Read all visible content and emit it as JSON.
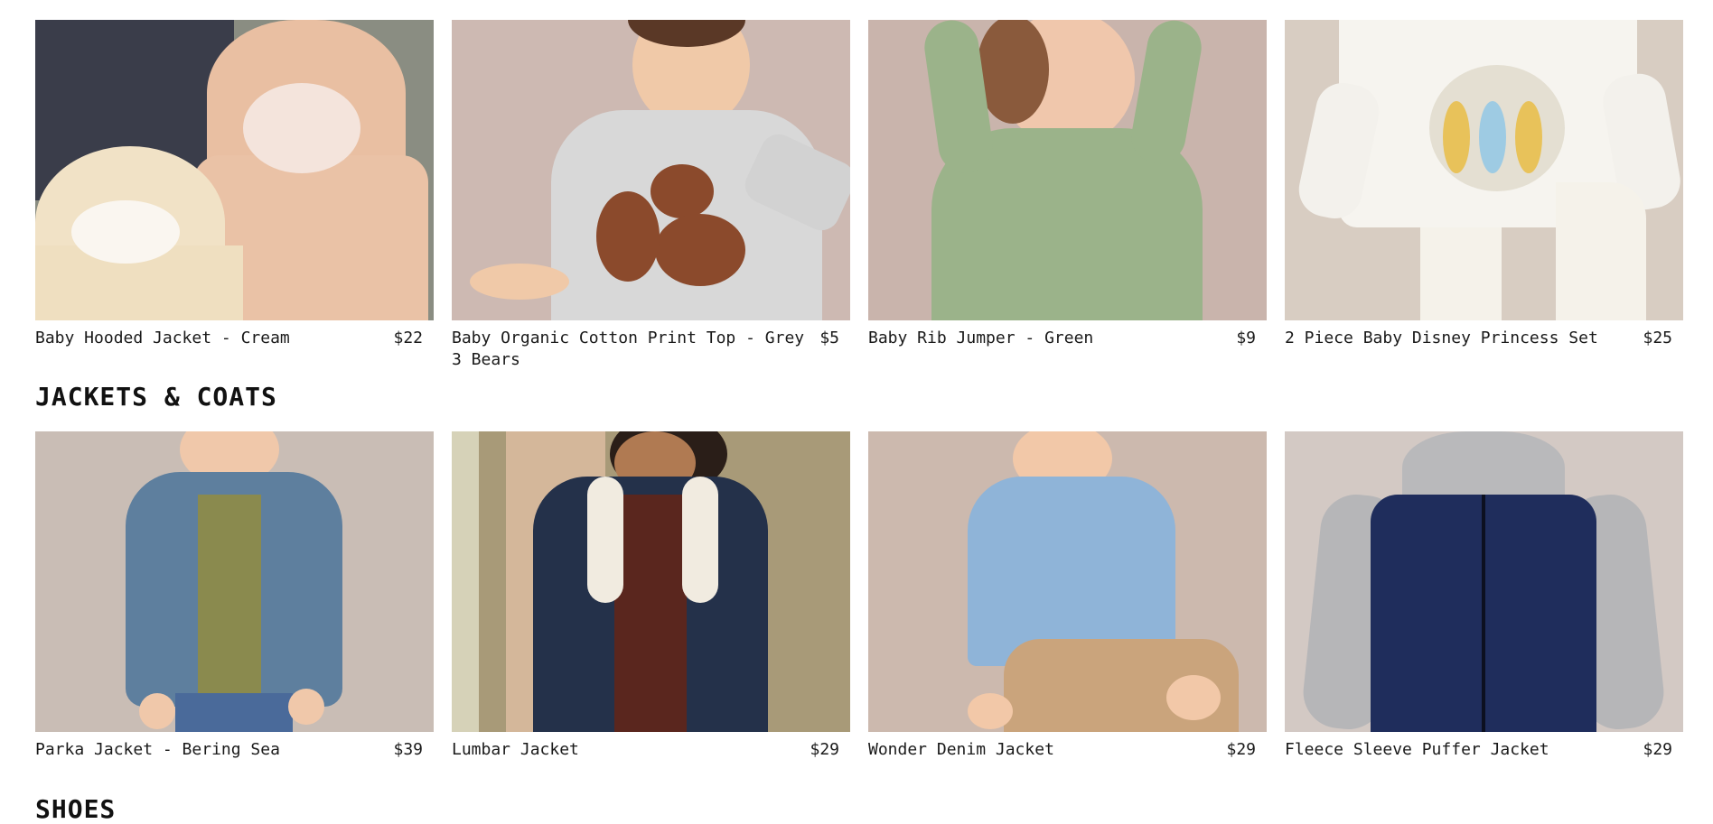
{
  "rows": [
    {
      "products": [
        {
          "name": "Baby Hooded Jacket - Cream",
          "price": "$22",
          "bg": "#8a8d82"
        },
        {
          "name": "Baby Organic Cotton Print Top - Grey 3 Bears",
          "price": "$5",
          "bg": "#cdb9b2"
        },
        {
          "name": "Baby Rib Jumper - Green",
          "price": "$9",
          "bg": "#c9b4ac"
        },
        {
          "name": "2 Piece Baby Disney Princess Set",
          "price": "$25",
          "bg": "#d8cdc2"
        }
      ]
    },
    {
      "products": [
        {
          "name": "Parka Jacket - Bering Sea",
          "price": "$39",
          "bg": "#c9bdb5"
        },
        {
          "name": "Lumbar Jacket",
          "price": "$29",
          "bg": "#a89a78"
        },
        {
          "name": "Wonder Denim Jacket",
          "price": "$29",
          "bg": "#ccb9ae"
        },
        {
          "name": "Fleece Sleeve Puffer Jacket",
          "price": "$29",
          "bg": "#d3c9c4"
        }
      ]
    }
  ],
  "sections": {
    "jackets_title": "JACKETS & COATS",
    "shoes_title": "SHOES"
  }
}
